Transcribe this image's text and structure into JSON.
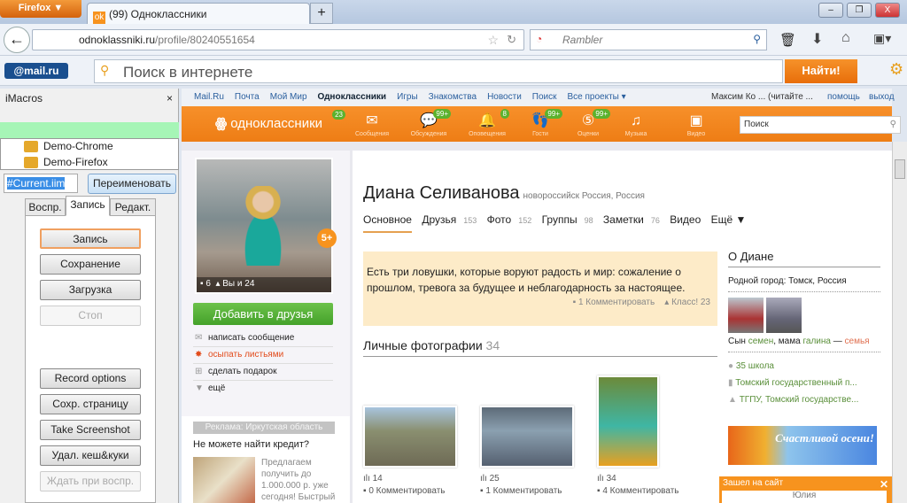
{
  "browser": {
    "menu_button": "Firefox ▼",
    "tab_title": "(99) Одноклассники",
    "new_tab": "+",
    "url_domain": "odnoklassniki.ru",
    "url_path": "/profile/80240551654",
    "search_engine": "Rambler",
    "window_buttons": [
      "‒",
      "❐",
      "X"
    ]
  },
  "mailbar": {
    "logo": "@mail.ru",
    "search_placeholder": "Поиск в интернете",
    "find_button": "Найти!"
  },
  "imacros": {
    "title": "iMacros",
    "close": "×",
    "tree": [
      "Demo-Chrome",
      "Demo-Firefox"
    ],
    "current_file": "#Current.iim",
    "rename_button": "Переименовать",
    "tabs": [
      "Воспр.",
      "Запись",
      "Редакт."
    ],
    "active_tab": "Запись",
    "buttons": [
      "Запись",
      "Сохранение",
      "Загрузка",
      "Стоп",
      "Record options",
      "Сохр. страницу",
      "Take Screenshot",
      "Удал. кеш&куки",
      "Ждать при воспр."
    ]
  },
  "portal": {
    "links": [
      "Mail.Ru",
      "Почта",
      "Мой Мир",
      "Одноклассники",
      "Игры",
      "Знакомства",
      "Новости",
      "Поиск",
      "Все проекты ▾"
    ],
    "user": "Максим Ко ... (читайте ...",
    "help": "помощь",
    "logout": "выход"
  },
  "ok_nav": {
    "logo": "одноклассники",
    "logo_badge": "23",
    "items": [
      {
        "label": "Сообщения",
        "icon": "envelope-icon",
        "glyph": "✉",
        "badge": ""
      },
      {
        "label": "Обсуждения",
        "icon": "chat-icon",
        "glyph": "💬",
        "badge": "99+"
      },
      {
        "label": "Оповещения",
        "icon": "bell-icon",
        "glyph": "🔔",
        "badge": "8"
      },
      {
        "label": "Гости",
        "icon": "footprints-icon",
        "glyph": "👣",
        "badge": "99+"
      },
      {
        "label": "Оценки",
        "icon": "rating-icon",
        "glyph": "⑤",
        "badge": "99+"
      },
      {
        "label": "Музыка",
        "icon": "music-icon",
        "glyph": "♫",
        "badge": ""
      },
      {
        "label": "Видео",
        "icon": "video-icon",
        "glyph": "▣",
        "badge": ""
      }
    ],
    "search_placeholder": "Поиск"
  },
  "profile": {
    "name": "Диана Селиванова",
    "location": "новороссийск Россия, Россия",
    "badge": "5+",
    "photo_comments": "6",
    "photo_likes": "Вы и 24",
    "add_friend": "Добавить в друзья",
    "actions": [
      "написать сообщение",
      "осыпать листьями",
      "сделать подарок",
      "ещё"
    ],
    "tabs": [
      {
        "label": "Основное",
        "count": ""
      },
      {
        "label": "Друзья",
        "count": "153"
      },
      {
        "label": "Фото",
        "count": "152"
      },
      {
        "label": "Группы",
        "count": "98"
      },
      {
        "label": "Заметки",
        "count": "76"
      },
      {
        "label": "Видео",
        "count": ""
      },
      {
        "label": "Ещё ▼",
        "count": ""
      }
    ],
    "status": "Есть три ловушки, которые воруют радость и мир: сожаление о прошлом, тревога за будущее и неблагодарность за настоящее.",
    "status_comments": "1 Комментировать",
    "status_likes": "Класс! 23"
  },
  "photos": {
    "title": "Личные фотографии",
    "count": "34",
    "items": [
      {
        "likes": "14",
        "comments": "0 Комментировать"
      },
      {
        "likes": "25",
        "comments": "1 Комментировать"
      },
      {
        "likes": "34",
        "comments": "4 Комментировать"
      }
    ]
  },
  "about": {
    "title": "О Диане",
    "hometown": "Родной город: Томск, Россия",
    "family_prefix": "Сын",
    "son": "семен",
    "mid": ", мама",
    "mother": "галина",
    "dash": "—",
    "family_link": "семья",
    "edu": [
      "35 школа",
      "Томский государственный п...",
      "ТГПУ, Томский государстве..."
    ],
    "banner": "Счастливой осени!"
  },
  "ad": {
    "header": "Реклама: Иркутская область",
    "title": "Не можете найти кредит?",
    "text": "Предлагаем получить до 1.000.000 р. уже сегодня! Быстрый"
  },
  "online": {
    "title": "Зашел на сайт",
    "close": "✕",
    "name": "Юлия"
  }
}
